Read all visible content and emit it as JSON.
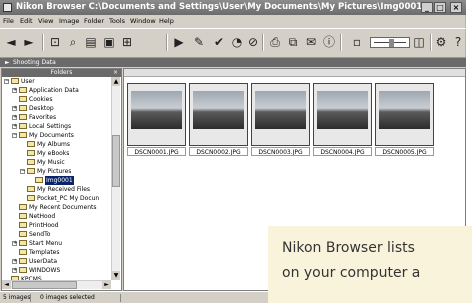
{
  "window": {
    "title": "Nikon Browser C:\\Documents and Settings\\User\\My Documents\\My Pictures\\Img0001",
    "controls": {
      "minimize": "_",
      "maximize": "□",
      "close": "×"
    }
  },
  "menu": [
    "File",
    "Edit",
    "View",
    "Image",
    "Folder",
    "Tools",
    "Window",
    "Help"
  ],
  "shooting_data_label": "Shooting Data",
  "folders_panel": {
    "header": "Folders",
    "close_glyph": "×",
    "tree": [
      {
        "label": "User",
        "expander": "−"
      },
      {
        "label": "Application Data",
        "expander": "+"
      },
      {
        "label": "Cookies",
        "expander": ""
      },
      {
        "label": "Desktop",
        "expander": "+"
      },
      {
        "label": "Favorites",
        "expander": "+"
      },
      {
        "label": "Local Settings",
        "expander": "+"
      },
      {
        "label": "My Documents",
        "expander": "−"
      },
      {
        "label": "My Albums",
        "expander": ""
      },
      {
        "label": "My eBooks",
        "expander": ""
      },
      {
        "label": "My Music",
        "expander": ""
      },
      {
        "label": "My Pictures",
        "expander": "−"
      },
      {
        "label": "Img0001",
        "expander": "",
        "selected": true
      },
      {
        "label": "My Received Files",
        "expander": ""
      },
      {
        "label": "Pocket_PC My Docun",
        "expander": ""
      },
      {
        "label": "My Recent Documents",
        "expander": ""
      },
      {
        "label": "NetHood",
        "expander": ""
      },
      {
        "label": "PrintHood",
        "expander": ""
      },
      {
        "label": "SendTo",
        "expander": ""
      },
      {
        "label": "Start Menu",
        "expander": "+"
      },
      {
        "label": "Templates",
        "expander": ""
      },
      {
        "label": "UserData",
        "expander": "+"
      },
      {
        "label": "WINDOWS",
        "expander": "+"
      },
      {
        "label": "KPCMS",
        "expander": ""
      }
    ]
  },
  "thumbnails": [
    {
      "filename": "DSCN0001.JPG"
    },
    {
      "filename": "DSCN0002.JPG"
    },
    {
      "filename": "DSCN0003.JPG"
    },
    {
      "filename": "DSCN0004.JPG"
    },
    {
      "filename": "DSCN0005.JPG"
    }
  ],
  "status": {
    "count": "5 images",
    "selected": "0 images selected"
  },
  "callout": {
    "line1": "Nikon Browser lists",
    "line2": "on your computer a"
  }
}
